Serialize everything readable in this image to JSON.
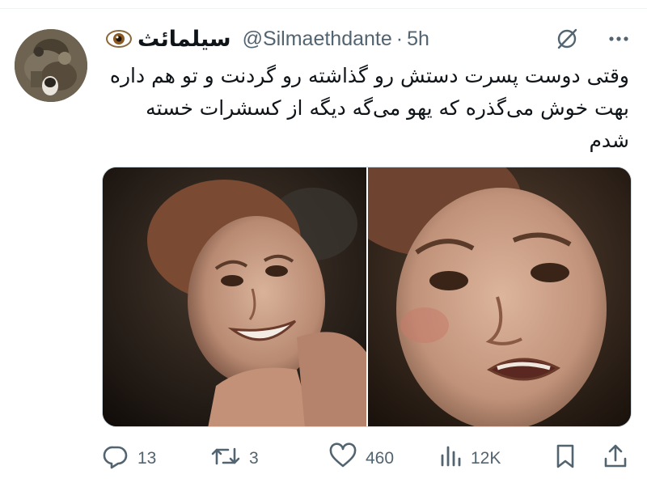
{
  "tweet": {
    "display_name": "سیلمائث",
    "handle": "@Silmaethdante",
    "separator": "·",
    "time": "5h",
    "text": "وقتی دوست پسرت دستش رو گذاشته رو گردنت و تو هم داره بهت خوش می‌گذره که یهو می‌گه دیگه از کسشرات خسته شدم"
  },
  "icons": {
    "name_emoji": "eye-emoji-icon",
    "grok": "grok-icon",
    "more": "more-icon",
    "reply": "reply-icon",
    "retweet": "retweet-icon",
    "like": "heart-icon",
    "views": "views-icon",
    "bookmark": "bookmark-icon",
    "share": "share-icon"
  },
  "metrics": {
    "replies": "13",
    "retweets": "3",
    "likes": "460",
    "views": "12K"
  },
  "colors": {
    "text_primary": "#0f1419",
    "text_secondary": "#536471",
    "divider": "#eff3f4"
  }
}
